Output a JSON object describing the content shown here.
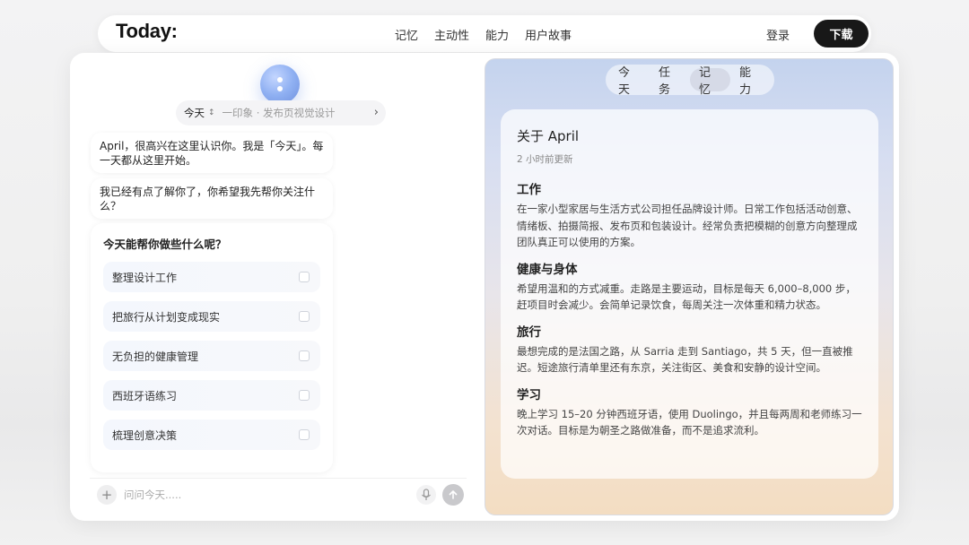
{
  "nav": {
    "logo": "Today:",
    "links": [
      "记忆",
      "主动性",
      "能力",
      "用户故事"
    ],
    "login": "登录",
    "download": "下载"
  },
  "chat": {
    "context": {
      "day": "今天",
      "sort_glyph": "↕",
      "tags": "一印象 · 发布页视觉设计",
      "arrow": "›"
    },
    "messages": [
      "April，很高兴在这里认识你。我是「今天」。每一天都从这里开始。",
      "我已经有点了解你了，你希望我先帮你关注什么？"
    ],
    "help_title": "今天能帮你做些什么呢？",
    "help_items": [
      "整理设计工作",
      "把旅行从计划变成现实",
      "无负担的健康管理",
      "西班牙语练习",
      "梳理创意决策"
    ],
    "input": {
      "placeholder": "问问今天.....",
      "value": ""
    }
  },
  "memory": {
    "tabs": [
      "今天",
      "任务",
      "记忆",
      "能力"
    ],
    "active_tab": "记忆",
    "title": "关于 April",
    "updated": "2 小时前更新",
    "sections": [
      {
        "heading": "工作",
        "text": "在一家小型家居与生活方式公司担任品牌设计师。日常工作包括活动创意、情绪板、拍摄简报、发布页和包装设计。经常负责把模糊的创意方向整理成团队真正可以使用的方案。"
      },
      {
        "heading": "健康与身体",
        "text": "希望用温和的方式减重。走路是主要运动，目标是每天 6,000–8,000 步，赶项目时会减少。会简单记录饮食，每周关注一次体重和精力状态。"
      },
      {
        "heading": "旅行",
        "text": "最想完成的是法国之路，从 Sarria 走到 Santiago，共 5 天，但一直被推迟。短途旅行清单里还有东京，关注街区、美食和安静的设计空间。"
      },
      {
        "heading": "学习",
        "text": "晚上学习 15–20 分钟西班牙语，使用 Duolingo，并且每两周和老师练习一次对话。目标是为朝圣之路做准备，而不是追求流利。"
      }
    ]
  },
  "colors": {
    "download_button": "#181818",
    "avatar_accent": "#8fb0f2",
    "panel_top": "#c4d3ee",
    "panel_bottom": "#f3ddc2"
  }
}
